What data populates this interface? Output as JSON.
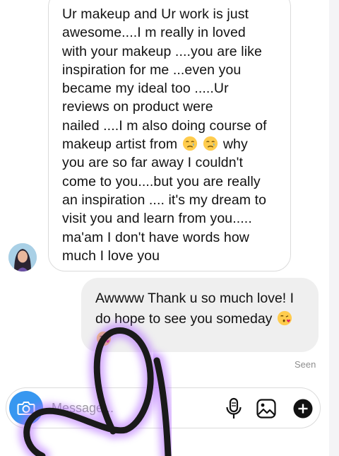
{
  "received_message": {
    "lines": [
      "Ur makeup and Ur work is just",
      "awesome....I m really in loved",
      "with your makeup ....you are like",
      "inspiration for me ...even you",
      "became my ideal too .....Ur",
      "reviews on product were",
      "nailed ....I m also doing course of",
      "makeup artist from",
      "why",
      "you are so far away I couldn't",
      "come to you....but you are really",
      "an inspiration .... it's my dream to",
      "visit you and learn from you.....",
      "ma'am I don't have words how",
      "much I love you"
    ],
    "emoji": [
      "crying-face-icon",
      "crying-face-icon"
    ]
  },
  "sent_message": {
    "lines": [
      "Awwww Thank u so much love! I",
      "do hope to see you someday"
    ],
    "emoji": [
      "face-blowing-kiss-icon",
      "face-blowing-kiss-icon"
    ]
  },
  "status": {
    "seen": "Seen"
  },
  "composer": {
    "placeholder": "Message..."
  },
  "colors": {
    "camera_button": "#3797f0",
    "sent_bubble": "#efefef",
    "doodle_stroke": "#1a1a1a",
    "doodle_glow": "#b36bff"
  }
}
